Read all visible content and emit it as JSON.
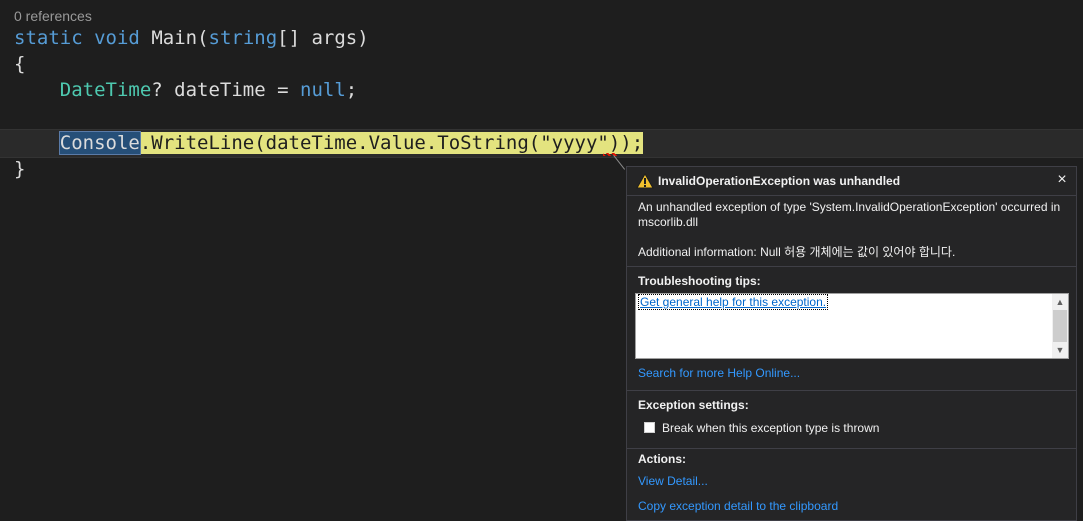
{
  "editor": {
    "codelens": "0 references",
    "line1": {
      "kw_static": "static",
      "kw_void": "void",
      "name": "Main(",
      "kw_string": "string",
      "rest": "[] args)"
    },
    "line2": "{",
    "line3": {
      "type": "DateTime",
      "mid": "? dateTime = ",
      "kw_null": "null",
      "end": ";"
    },
    "line4": {
      "token": "Console",
      "mid": ".WriteLine(dateTime.Value.ToString(",
      "str": "\"yyyy\"",
      "end": "));"
    },
    "line5": "}"
  },
  "popup": {
    "title": "InvalidOperationException was unhandled",
    "close_glyph": "×",
    "message": "An unhandled exception of type 'System.InvalidOperationException' occurred in mscorlib.dll",
    "additional_info": "Additional information: Null 허용 개체에는 값이 있어야 합니다.",
    "troubleshooting_heading": "Troubleshooting tips:",
    "tips": [
      "Get general help for this exception."
    ],
    "search_link": "Search for more Help Online...",
    "exception_settings_heading": "Exception settings:",
    "break_checkbox_label": "Break when this exception type is thrown",
    "break_checked": false,
    "actions_heading": "Actions:",
    "view_detail": "View Detail...",
    "copy_detail": "Copy exception detail to the clipboard"
  },
  "colors": {
    "background": "#1e1e1e",
    "keyword": "#569cd6",
    "type": "#4ec9b0",
    "string": "#d69d85",
    "exec_highlight": "#e3e37f",
    "link": "#3399ff",
    "warning": "#f2c12e"
  },
  "icons": {
    "warning": "warning-triangle-icon",
    "close": "close-icon",
    "scroll_up": "scroll-up-arrow-icon",
    "scroll_down": "scroll-down-arrow-icon"
  }
}
